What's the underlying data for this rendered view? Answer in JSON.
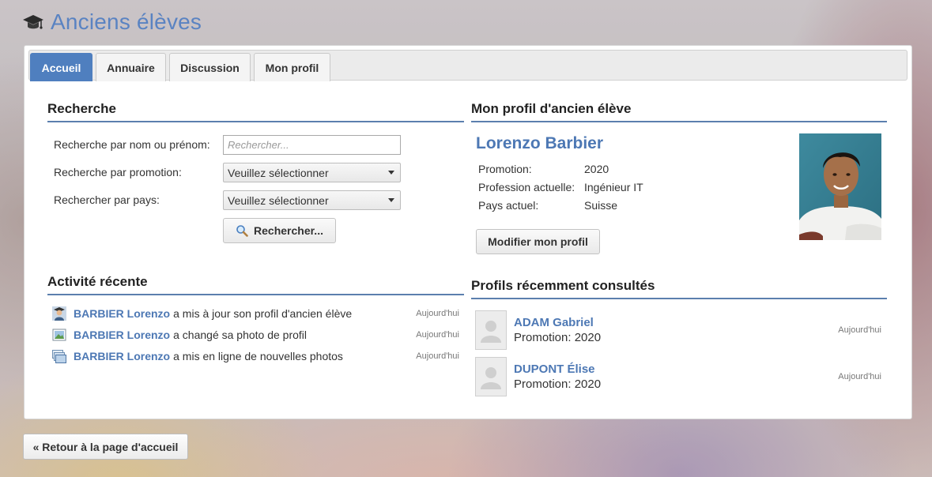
{
  "app": {
    "title": "Anciens élèves",
    "title_icon": "graduation-cap-icon"
  },
  "tabs": [
    {
      "label": "Accueil",
      "active": true
    },
    {
      "label": "Annuaire",
      "active": false
    },
    {
      "label": "Discussion",
      "active": false
    },
    {
      "label": "Mon profil",
      "active": false
    }
  ],
  "search": {
    "title": "Recherche",
    "name_label": "Recherche par nom ou prénom:",
    "name_placeholder": "Rechercher...",
    "name_value": "",
    "promo_label": "Recherche par promotion:",
    "promo_selected": "Veuillez sélectionner",
    "country_label": "Rechercher par pays:",
    "country_selected": "Veuillez sélectionner",
    "button_label": "Rechercher...",
    "button_icon": "magnifier-icon"
  },
  "activity": {
    "title": "Activité récente",
    "items": [
      {
        "icon": "user-avatar-icon",
        "name": "BARBIER Lorenzo",
        "text": "a mis à jour son profil d'ancien élève",
        "when": "Aujourd'hui"
      },
      {
        "icon": "picture-icon",
        "name": "BARBIER Lorenzo",
        "text": "a changé sa photo de profil",
        "when": "Aujourd'hui"
      },
      {
        "icon": "photos-stack-icon",
        "name": "BARBIER Lorenzo",
        "text": "a mis en ligne de nouvelles photos",
        "when": "Aujourd'hui"
      }
    ]
  },
  "profile": {
    "title": "Mon profil d'ancien élève",
    "name": "Lorenzo Barbier",
    "fields": [
      {
        "label": "Promotion:",
        "value": "2020"
      },
      {
        "label": "Profession actuelle:",
        "value": "Ingénieur IT"
      },
      {
        "label": "Pays actuel:",
        "value": "Suisse"
      }
    ],
    "edit_button": "Modifier mon profil"
  },
  "recent_profiles": {
    "title": "Profils récemment consultés",
    "items": [
      {
        "name": "ADAM Gabriel",
        "promotion": "Promotion: 2020",
        "when": "Aujourd'hui"
      },
      {
        "name": "DUPONT Élise",
        "promotion": "Promotion: 2020",
        "when": "Aujourd'hui"
      }
    ]
  },
  "footer": {
    "back_button": "« Retour à la page d'accueil"
  },
  "colors": {
    "accent": "#4f7fbf",
    "link": "#4d78b4",
    "title": "#5a83c2"
  }
}
